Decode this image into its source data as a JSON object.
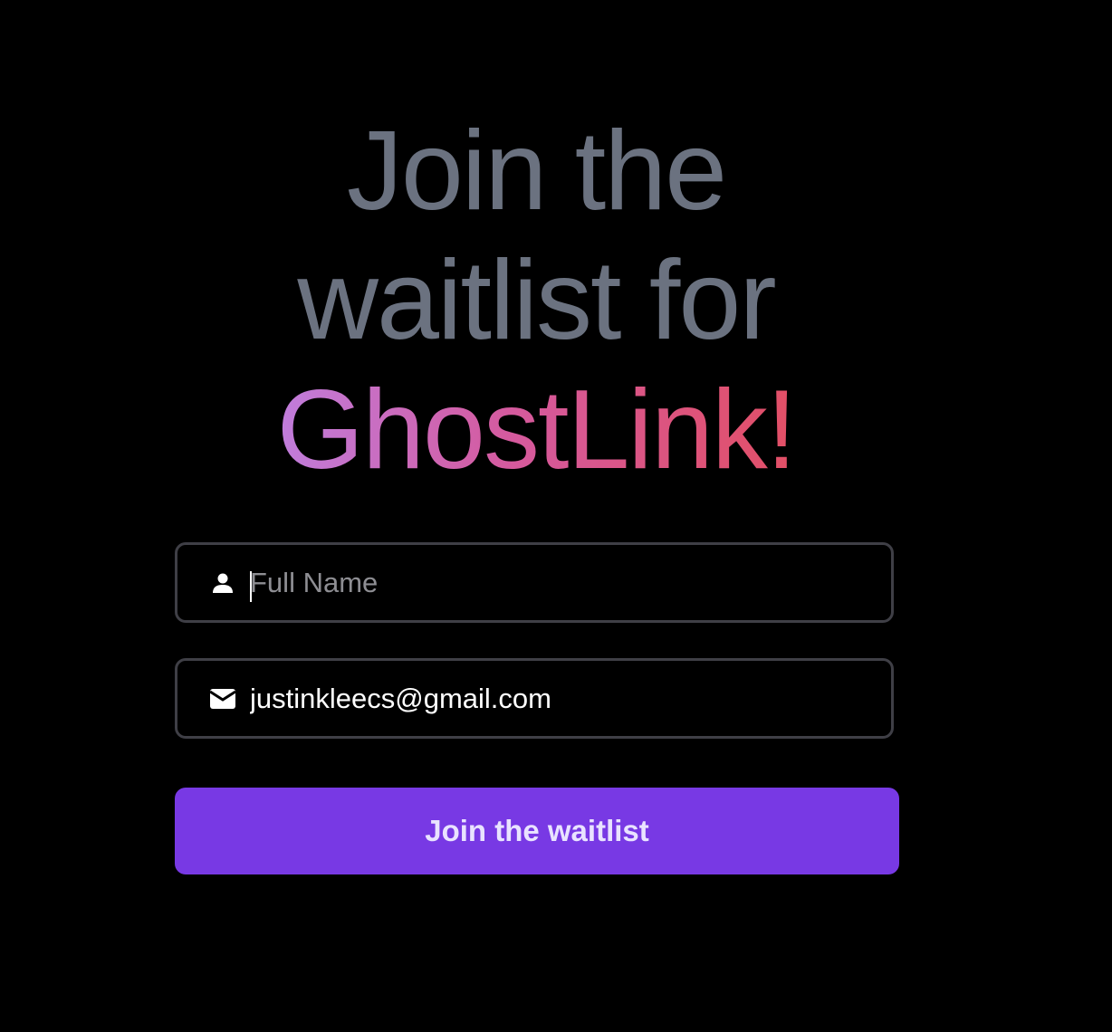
{
  "hero": {
    "line1": "Join the",
    "line2": "waitlist for",
    "brand": "GhostLink!"
  },
  "form": {
    "name_field": {
      "placeholder": "Full Name",
      "value": "",
      "icon": "user-icon"
    },
    "email_field": {
      "value": "justinkleecs@gmail.com",
      "icon": "envelope-icon"
    },
    "submit_label": "Join the waitlist"
  },
  "colors": {
    "background": "#000000",
    "headline_gray": "#6b7280",
    "brand_gradient": [
      "#c07ddc",
      "#d55a9e",
      "#e24f66"
    ],
    "field_border": "#3f3f46",
    "button": "#7839e4",
    "button_text": "#e9e3ff"
  }
}
